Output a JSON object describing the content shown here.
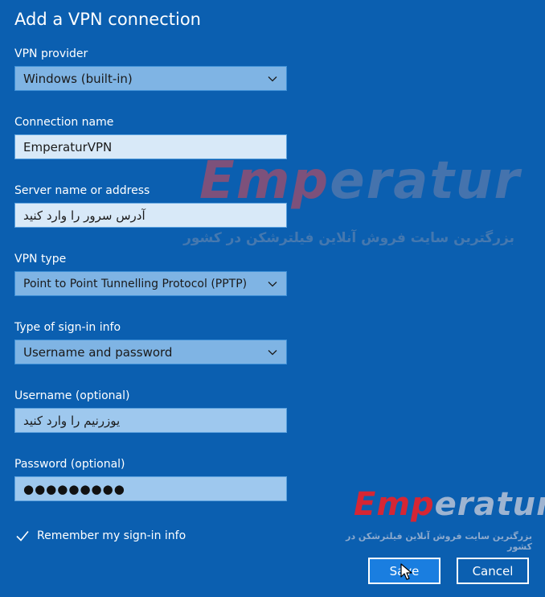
{
  "dialog": {
    "title": "Add a VPN connection"
  },
  "fields": {
    "vpn_provider": {
      "label": "VPN provider",
      "value": "Windows (built-in)"
    },
    "connection_name": {
      "label": "Connection name",
      "value": "EmperaturVPN"
    },
    "server": {
      "label": "Server name or address",
      "value": "آدرس سرور را وارد کنید"
    },
    "vpn_type": {
      "label": "VPN type",
      "value": "Point to Point Tunnelling Protocol (PPTP)"
    },
    "signin_type": {
      "label": "Type of sign-in info",
      "value": "Username and password"
    },
    "username": {
      "label": "Username (optional)",
      "value": "یوزرنیم را وارد کنید"
    },
    "password": {
      "label": "Password (optional)",
      "value": "●●●●●●●●●"
    }
  },
  "remember": {
    "label": "Remember my sign-in info",
    "checked": true
  },
  "buttons": {
    "save": "Save",
    "cancel": "Cancel"
  },
  "watermark": {
    "brand_first": "Emp",
    "brand_rest": "eratur",
    "tagline": "بزرگترین سایت فروش آنلاین فیلترشکن در کشور"
  },
  "colors": {
    "background": "#0b5fb0",
    "select_fill": "#7fb4e4",
    "text_fill": "#d8e9f8",
    "save_fill": "#1a7ee0",
    "watermark_red": "#e1232d"
  },
  "icons": {
    "dropdown": "chevron-down-icon",
    "checkbox": "checkmark-icon",
    "cursor": "mouse-pointer-icon"
  }
}
